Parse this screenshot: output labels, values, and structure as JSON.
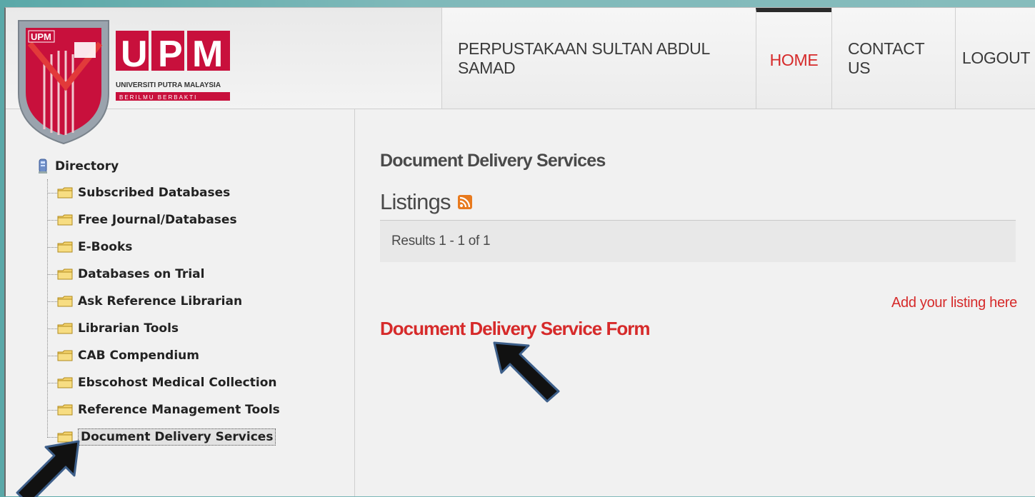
{
  "logo": {
    "upm_text": "UPM",
    "university": "UNIVERSITI PUTRA MALAYSIA",
    "motto": "BERILMU BERBAKTI",
    "badge_text": "UPM"
  },
  "nav": {
    "library": "PERPUSTAKAAN SULTAN ABDUL SAMAD",
    "home": "HOME",
    "contact": "CONTACT US",
    "logout": "LOGOUT"
  },
  "sidebar": {
    "root_label": "Directory",
    "items": [
      {
        "label": "Subscribed Databases"
      },
      {
        "label": "Free Journal/Databases"
      },
      {
        "label": "E-Books"
      },
      {
        "label": "Databases on Trial"
      },
      {
        "label": "Ask Reference Librarian"
      },
      {
        "label": "Librarian Tools"
      },
      {
        "label": "CAB Compendium"
      },
      {
        "label": "Ebscohost Medical Collection"
      },
      {
        "label": "Reference Management Tools"
      },
      {
        "label": "Document Delivery Services",
        "selected": true
      }
    ]
  },
  "main": {
    "section_title": "Document Delivery Services",
    "listings_heading": "Listings",
    "results_text": "Results 1 - 1 of 1",
    "add_listing": "Add your listing here",
    "listing_title": "Document Delivery Service Form"
  },
  "colors": {
    "accent_red": "#d62a2a",
    "logo_red": "#c8103c",
    "rss_orange": "#e87a1e"
  },
  "icons": [
    "computer-icon",
    "folder-icon",
    "rss-icon",
    "arrow-pointer-icon"
  ]
}
